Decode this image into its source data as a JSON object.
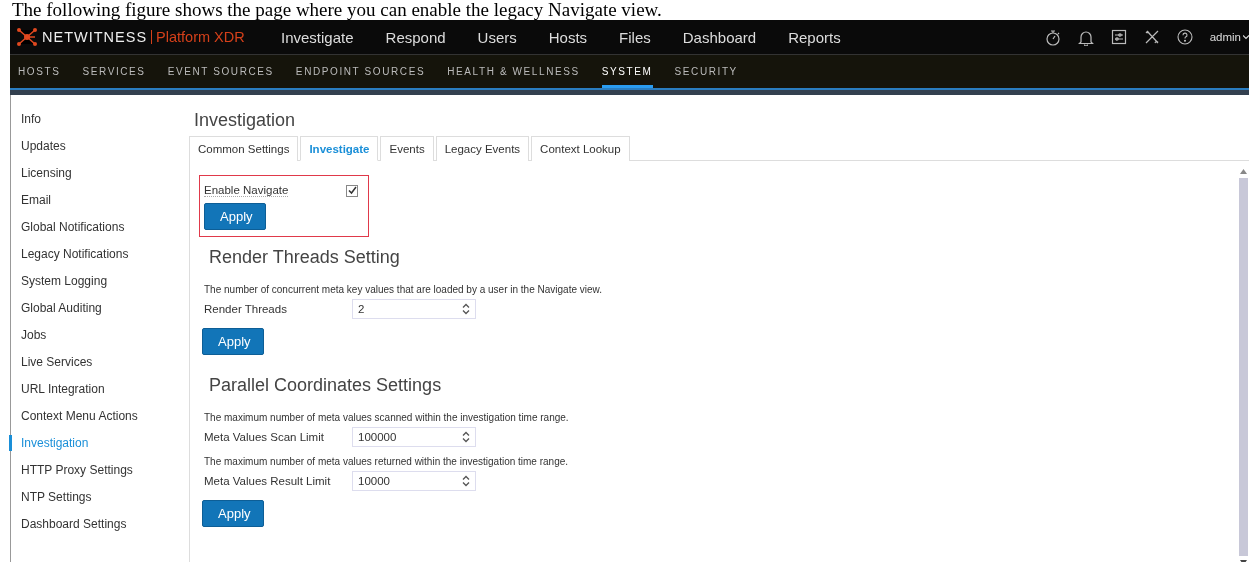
{
  "caption": "The following figure shows the page where you can enable the legacy Navigate view.",
  "brand": {
    "name": "NETWITNESS",
    "product": "Platform XDR"
  },
  "main_nav": [
    {
      "label": "Investigate"
    },
    {
      "label": "Respond"
    },
    {
      "label": "Users"
    },
    {
      "label": "Hosts"
    },
    {
      "label": "Files"
    },
    {
      "label": "Dashboard"
    },
    {
      "label": "Reports"
    }
  ],
  "user": {
    "name": "admin"
  },
  "sub_nav": [
    {
      "label": "HOSTS",
      "selected": false
    },
    {
      "label": "SERVICES",
      "selected": false
    },
    {
      "label": "EVENT SOURCES",
      "selected": false
    },
    {
      "label": "ENDPOINT SOURCES",
      "selected": false
    },
    {
      "label": "HEALTH & WELLNESS",
      "selected": false
    },
    {
      "label": "SYSTEM",
      "selected": true
    },
    {
      "label": "SECURITY",
      "selected": false
    }
  ],
  "sidebar": {
    "items": [
      {
        "label": "Info",
        "selected": false
      },
      {
        "label": "Updates",
        "selected": false
      },
      {
        "label": "Licensing",
        "selected": false
      },
      {
        "label": "Email",
        "selected": false
      },
      {
        "label": "Global Notifications",
        "selected": false
      },
      {
        "label": "Legacy Notifications",
        "selected": false
      },
      {
        "label": "System Logging",
        "selected": false
      },
      {
        "label": "Global Auditing",
        "selected": false
      },
      {
        "label": "Jobs",
        "selected": false
      },
      {
        "label": "Live Services",
        "selected": false
      },
      {
        "label": "URL Integration",
        "selected": false
      },
      {
        "label": "Context Menu Actions",
        "selected": false
      },
      {
        "label": "Investigation",
        "selected": true
      },
      {
        "label": "HTTP Proxy Settings",
        "selected": false
      },
      {
        "label": "NTP Settings",
        "selected": false
      },
      {
        "label": "Dashboard Settings",
        "selected": false
      }
    ]
  },
  "page": {
    "title": "Investigation",
    "tabs": [
      {
        "label": "Common Settings",
        "selected": false
      },
      {
        "label": "Investigate",
        "selected": true
      },
      {
        "label": "Events",
        "selected": false
      },
      {
        "label": "Legacy Events",
        "selected": false
      },
      {
        "label": "Context Lookup",
        "selected": false
      }
    ],
    "navigate": {
      "label": "Enable Navigate",
      "checked": true,
      "highlighted": true,
      "button": "Apply"
    },
    "sections": [
      {
        "title": "Render Threads Setting",
        "fields": [
          {
            "description": "The number of concurrent meta key values that are loaded by a user in the Navigate view.",
            "label": "Render Threads",
            "value": "2"
          }
        ],
        "button": "Apply"
      },
      {
        "title": "Parallel Coordinates Settings",
        "fields": [
          {
            "description": "The maximum number of meta values scanned within the investigation time range.",
            "label": "Meta Values Scan Limit",
            "value": "100000"
          },
          {
            "description": "The maximum number of meta values returned within the investigation time range.",
            "label": "Meta Values Result Limit",
            "value": "10000"
          }
        ],
        "button": "Apply"
      }
    ]
  }
}
